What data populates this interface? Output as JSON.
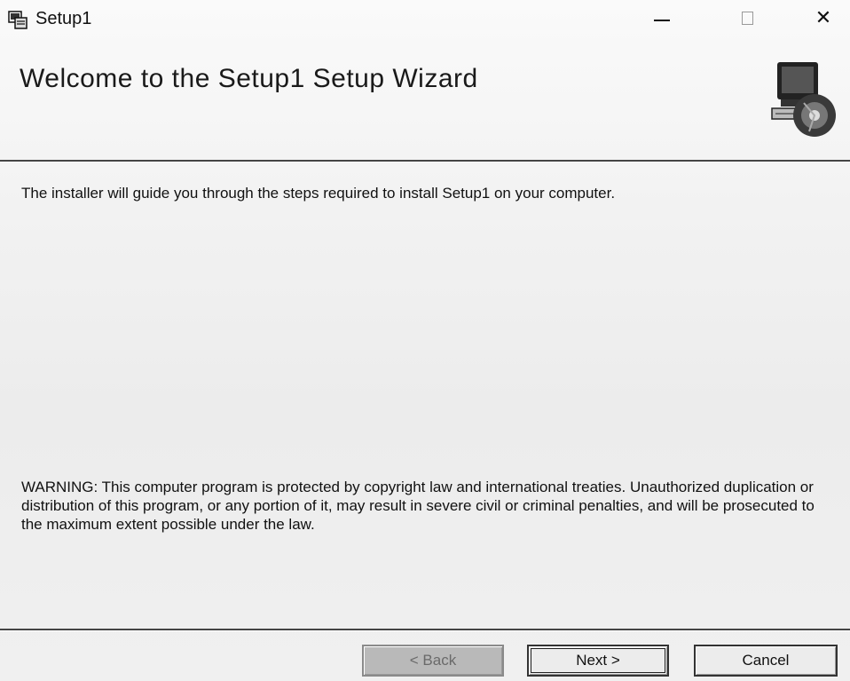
{
  "window": {
    "title": "Setup1",
    "controls": {
      "minimize_icon": "minimize-icon",
      "maximize_icon": "maximize-icon",
      "close_icon": "close-icon",
      "close_glyph": "✕"
    }
  },
  "header": {
    "title": "Welcome to the Setup1 Setup Wizard",
    "graphic_icon": "computer-cd-icon"
  },
  "body": {
    "intro": "The installer will guide you through the steps required to install Setup1 on your computer.",
    "warning": "WARNING: This computer program is protected by copyright law and international treaties. Unauthorized duplication or distribution of this program, or any portion of it, may result in severe civil or criminal penalties, and will be prosecuted to the maximum extent possible under the law."
  },
  "buttons": {
    "back": "< Back",
    "next": "Next >",
    "cancel": "Cancel"
  }
}
